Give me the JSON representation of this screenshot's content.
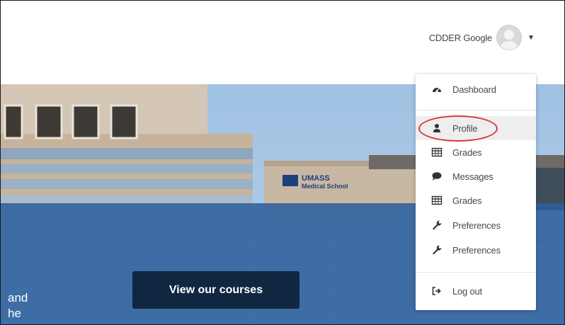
{
  "header": {
    "user_name": "CDDER Google",
    "avatar_icon": "user-avatar-icon",
    "caret_icon": "caret-down-icon"
  },
  "hero": {
    "cta_label": "View our courses",
    "side_text_line1": "and",
    "side_text_line2": "he",
    "building_sign_line1": "UMASS",
    "building_sign_line2": "Medical School"
  },
  "user_dropdown": {
    "items": [
      {
        "label": "Dashboard",
        "icon": "dashboard-icon"
      },
      {
        "label": "Profile",
        "icon": "user-icon"
      },
      {
        "label": "Grades",
        "icon": "table-icon"
      },
      {
        "label": "Messages",
        "icon": "comment-icon"
      },
      {
        "label": "Grades",
        "icon": "table-icon"
      },
      {
        "label": "Preferences",
        "icon": "wrench-icon"
      },
      {
        "label": "Preferences",
        "icon": "wrench-icon"
      },
      {
        "label": "Log out",
        "icon": "sign-out-icon"
      }
    ]
  },
  "colors": {
    "cta_bg": "#0f2740",
    "hero_blue_overlay": "#2d5f9a",
    "annotation_ring": "#d83a3a"
  }
}
